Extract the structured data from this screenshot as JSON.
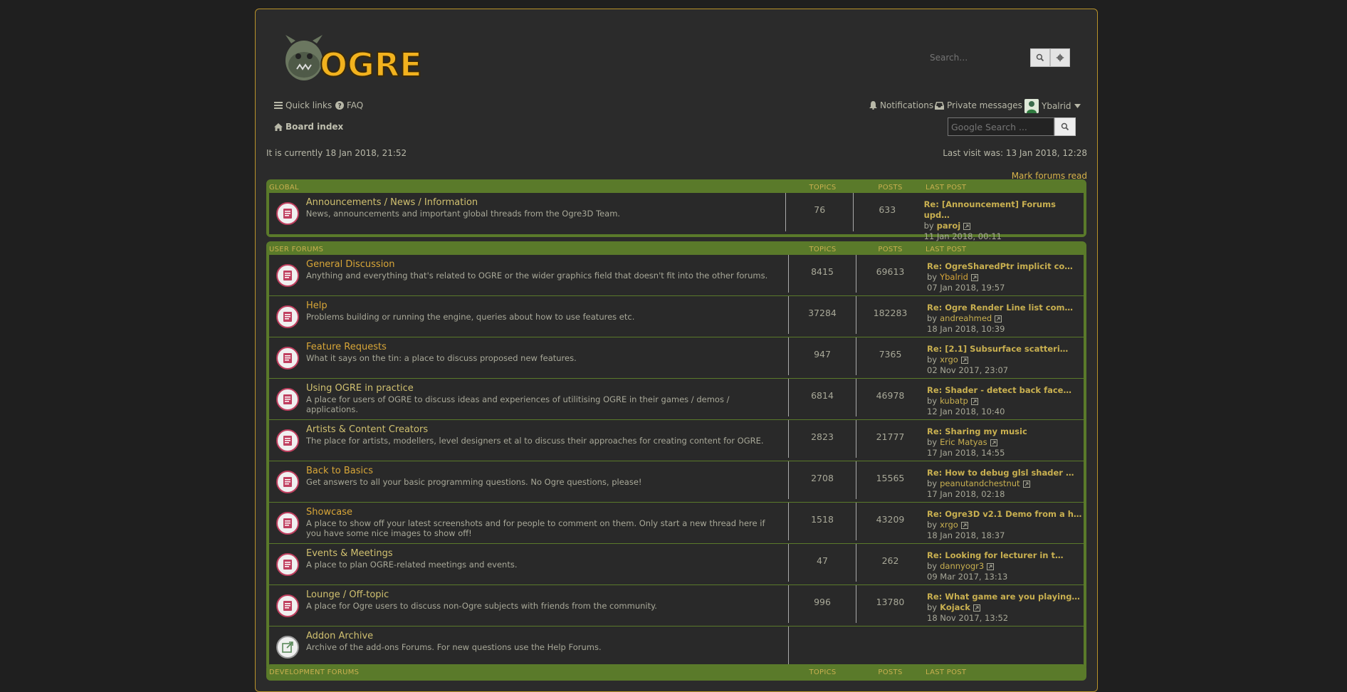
{
  "header": {
    "logo_text": "OGRE",
    "search_placeholder": "Search…",
    "google_search_placeholder": "Google Search ..."
  },
  "nav": {
    "quick_links": "Quick links",
    "faq": "FAQ",
    "notifications": "Notifications",
    "private_messages": "Private messages",
    "username": "Ybalrid",
    "board_index": "Board index"
  },
  "status": {
    "currently": "It is currently 18 Jan 2018, 21:52",
    "last_visit": "Last visit was: 13 Jan 2018, 12:28",
    "mark_read": "Mark forums read"
  },
  "columns": {
    "topics": "TOPICS",
    "posts": "POSTS",
    "last_post": "LAST POST"
  },
  "categories": [
    {
      "title": "GLOBAL",
      "forums": [
        {
          "name": "Announcements / News / Information",
          "desc": "News, announcements and important global threads from the Ogre3D Team.",
          "topics": "76",
          "posts": "633",
          "last_title": "Re: [Announcement] Forums upd…",
          "by": "by",
          "last_user": "paroj",
          "last_date": "11 Jan 2018, 00:11"
        }
      ]
    },
    {
      "title": "USER FORUMS",
      "forums": [
        {
          "name": "General Discussion",
          "desc": "Anything and everything that's related to OGRE or the wider graphics field that doesn't fit into the other forums.",
          "topics": "8415",
          "posts": "69613",
          "last_title": "Re: OgreSharedPtr implicit co…",
          "by": "by",
          "last_user": "Ybalrid",
          "last_date": "07 Jan 2018, 19:57"
        },
        {
          "name": "Help",
          "desc": "Problems building or running the engine, queries about how to use features etc.",
          "topics": "37284",
          "posts": "182283",
          "last_title": "Re: Ogre Render Line list com…",
          "by": "by",
          "last_user": "andreahmed",
          "last_date": "18 Jan 2018, 10:39"
        },
        {
          "name": "Feature Requests",
          "desc": "What it says on the tin: a place to discuss proposed new features.",
          "topics": "947",
          "posts": "7365",
          "last_title": "Re: [2.1] Subsurface scatteri…",
          "by": "by",
          "last_user": "xrgo",
          "last_date": "02 Nov 2017, 23:07"
        },
        {
          "name": "Using OGRE in practice",
          "desc": "A place for users of OGRE to discuss ideas and experiences of utilitising OGRE in their games / demos / applications.",
          "topics": "6814",
          "posts": "46978",
          "last_title": "Re: Shader - detect back face…",
          "by": "by",
          "last_user": "kubatp",
          "last_date": "12 Jan 2018, 10:40"
        },
        {
          "name": "Artists & Content Creators",
          "desc": "The place for artists, modellers, level designers et al to discuss their approaches for creating content for OGRE.",
          "topics": "2823",
          "posts": "21777",
          "last_title": "Re: Sharing my music",
          "by": "by",
          "last_user": "Eric Matyas",
          "last_date": "17 Jan 2018, 14:55"
        },
        {
          "name": "Back to Basics",
          "desc": "Get answers to all your basic programming questions. No Ogre questions, please!",
          "topics": "2708",
          "posts": "15565",
          "last_title": "Re: How to debug glsl shader …",
          "by": "by",
          "last_user": "peanutandchestnut",
          "last_date": "17 Jan 2018, 02:18"
        },
        {
          "name": "Showcase",
          "desc": "A place to show off your latest screenshots and for people to comment on them. Only start a new thread here if you have some nice images to show off!",
          "topics": "1518",
          "posts": "43209",
          "last_title": "Re: Ogre3D v2.1 Demo from a h…",
          "by": "by",
          "last_user": "xrgo",
          "last_date": "18 Jan 2018, 18:37"
        },
        {
          "name": "Events & Meetings",
          "desc": "A place to plan OGRE-related meetings and events.",
          "topics": "47",
          "posts": "262",
          "last_title": "Re: Looking for lecturer in t…",
          "by": "by",
          "last_user": "dannyogr3",
          "last_date": "09 Mar 2017, 13:13"
        },
        {
          "name": "Lounge / Off-topic",
          "desc": "A place for Ogre users to discuss non-Ogre subjects with friends from the community.",
          "topics": "996",
          "posts": "13780",
          "last_title": "Re: What game are you playing…",
          "by": "by",
          "last_user": "Kojack",
          "last_date": "18 Nov 2017, 13:52"
        },
        {
          "name": "Addon Archive",
          "desc": "Archive of the add-ons Forums. For new questions use the Help Forums.",
          "topics": "",
          "posts": "",
          "last_title": "",
          "by": "",
          "last_user": "",
          "last_date": ""
        }
      ]
    },
    {
      "title": "DEVELOPMENT FORUMS",
      "forums": []
    }
  ],
  "colors": {
    "accent_gold": "#d8a638",
    "link_olive": "#c9b050",
    "block_green": "#5a7a2a",
    "frame_border": "#b9922a"
  }
}
